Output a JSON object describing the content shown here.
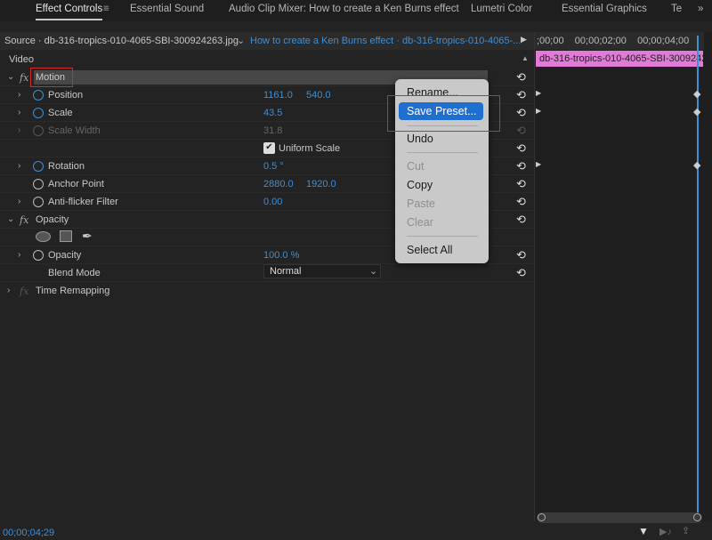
{
  "tabs": [
    "Effect Controls",
    "Essential Sound",
    "Audio Clip Mixer: How to create a Ken Burns effect",
    "Lumetri Color",
    "Essential Graphics",
    "Te"
  ],
  "source": {
    "label": "Source · db-316-tropics-010-4065-SBI-300924263.jpg",
    "sequence": "How to create a Ken Burns effect · db-316-tropics-010-4065-..."
  },
  "timeline": {
    "ruler": ";00;00    00;00;02;00    00;00;04;00",
    "clip": "db-316-tropics-010-4065-SBI-3009242"
  },
  "section": "Video",
  "motion": "Motion",
  "props": {
    "position": {
      "label": "Position",
      "x": "1161.0",
      "y": "540.0"
    },
    "scale": {
      "label": "Scale",
      "v": "43.5"
    },
    "scale_width": {
      "label": "Scale Width",
      "v": "31.8"
    },
    "uniform": "Uniform Scale",
    "rotation": {
      "label": "Rotation",
      "v": "0.5 °"
    },
    "anchor": {
      "label": "Anchor Point",
      "x": "2880.0",
      "y": "1920.0"
    },
    "antiflicker": {
      "label": "Anti-flicker Filter",
      "v": "0.00"
    }
  },
  "opacity_fx": "Opacity",
  "opacity": {
    "label": "Opacity",
    "v": "100.0 %"
  },
  "blend": {
    "label": "Blend Mode",
    "v": "Normal"
  },
  "time_remap": "Time Remapping",
  "menu": {
    "rename": "Rename...",
    "save": "Save Preset...",
    "undo": "Undo",
    "cut": "Cut",
    "copy": "Copy",
    "paste": "Paste",
    "clear": "Clear",
    "select_all": "Select All"
  },
  "timecode": "00;00;04;29",
  "fx": "fx"
}
